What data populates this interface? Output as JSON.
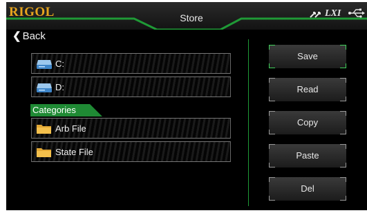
{
  "header": {
    "brand": "RIGOL",
    "title": "Store",
    "indicators": {
      "network_icon": "network-arrows-icon",
      "lxi": "LXI",
      "usb_icon": "usb-icon"
    }
  },
  "nav": {
    "back_label": "Back"
  },
  "drives": [
    {
      "label": "C:",
      "icon": "drive-icon"
    },
    {
      "label": "D:",
      "icon": "drive-icon"
    }
  ],
  "categories": {
    "heading": "Categories",
    "items": [
      {
        "label": "Arb File",
        "icon": "folder-icon"
      },
      {
        "label": "State File",
        "icon": "folder-icon"
      }
    ]
  },
  "actions": {
    "save": "Save",
    "read": "Read",
    "copy": "Copy",
    "paste": "Paste",
    "del": "Del"
  },
  "colors": {
    "brand": "#e7a51e",
    "accent_green": "#1f9a36",
    "background": "#000000",
    "text": "#f0f0f0"
  }
}
